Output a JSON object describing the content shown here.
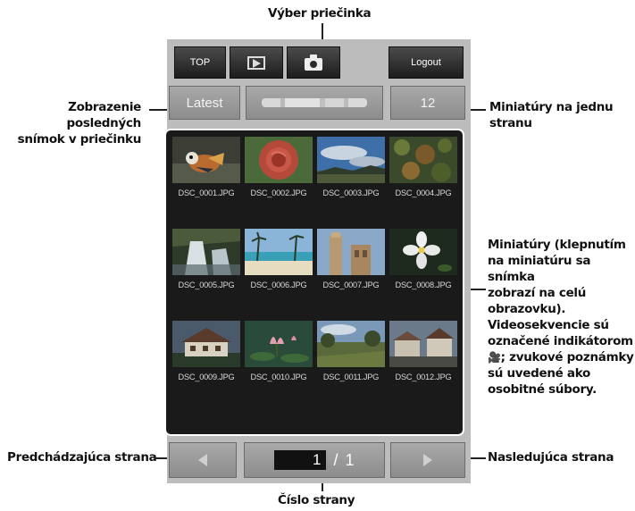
{
  "annotations": {
    "folder_select": "Výber priečinka",
    "latest": [
      "Zobrazenie posledných",
      "snímok v priečinku"
    ],
    "per_page": [
      "Miniatúry na jednu",
      "stranu"
    ],
    "thumbnails": [
      "Miniatúry (klepnutím",
      "na miniatúru sa snímka",
      "zobrazí na celú",
      "obrazovku).",
      "Videosekvencie sú",
      "označené indikátorom",
      "; zvukové poznámky",
      "sú uvedené ako",
      "osobitné súbory."
    ],
    "prev_page": "Predchádzajúca strana",
    "next_page": "Nasledujúca strana",
    "page_number": "Číslo strany"
  },
  "toolbar": {
    "top_label": "TOP",
    "play_icon": "play-mode-icon",
    "camera_icon": "camera-icon",
    "logout_label": "Logout"
  },
  "controls": {
    "latest_label": "Latest",
    "folder_name": "",
    "per_page_value": "12"
  },
  "thumbnails": [
    {
      "label": "DSC_0001.JPG",
      "subject": "duck"
    },
    {
      "label": "DSC_0002.JPG",
      "subject": "rose"
    },
    {
      "label": "DSC_0003.JPG",
      "subject": "sky"
    },
    {
      "label": "DSC_0004.JPG",
      "subject": "foliage"
    },
    {
      "label": "DSC_0005.JPG",
      "subject": "waterfall"
    },
    {
      "label": "DSC_0006.JPG",
      "subject": "beach"
    },
    {
      "label": "DSC_0007.JPG",
      "subject": "monument"
    },
    {
      "label": "DSC_0008.JPG",
      "subject": "flower"
    },
    {
      "label": "DSC_0009.JPG",
      "subject": "house"
    },
    {
      "label": "DSC_0010.JPG",
      "subject": "lotus"
    },
    {
      "label": "DSC_0011.JPG",
      "subject": "field"
    },
    {
      "label": "DSC_0012.JPG",
      "subject": "village"
    }
  ],
  "pagination": {
    "current": "1",
    "separator": "/",
    "total": "1",
    "prev_icon": "triangle-left-icon",
    "next_icon": "triangle-right-icon"
  }
}
